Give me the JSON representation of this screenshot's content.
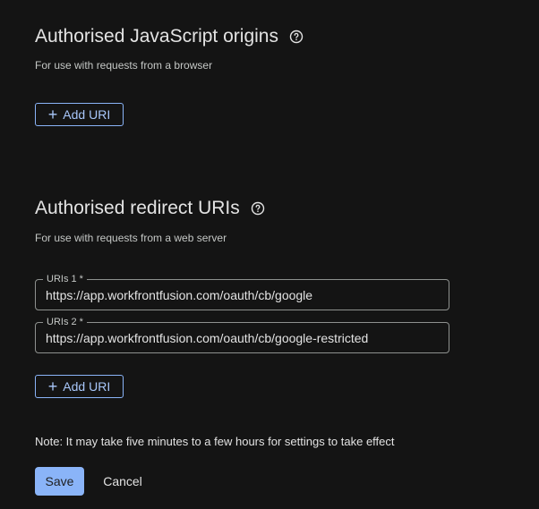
{
  "js_origins": {
    "title": "Authorised JavaScript origins",
    "help_icon": "help-circle-icon",
    "description": "For use with requests from a browser",
    "add_button_label": "Add URI",
    "add_icon": "plus-icon"
  },
  "redirect_uris": {
    "title": "Authorised redirect URIs",
    "help_icon": "help-circle-icon",
    "description": "For use with requests from a web server",
    "fields": [
      {
        "label": "URIs 1 *",
        "value": "https://app.workfrontfusion.com/oauth/cb/google"
      },
      {
        "label": "URIs 2 *",
        "value": "https://app.workfrontfusion.com/oauth/cb/google-restricted"
      }
    ],
    "add_button_label": "Add URI",
    "add_icon": "plus-icon"
  },
  "note": "Note: It may take five minutes to a few hours for settings to take effect",
  "actions": {
    "save_label": "Save",
    "cancel_label": "Cancel"
  },
  "colors": {
    "background": "#141414",
    "accent": "#8ab4f8",
    "text": "#e3e3e3",
    "secondary_text": "#c4c7c5"
  }
}
